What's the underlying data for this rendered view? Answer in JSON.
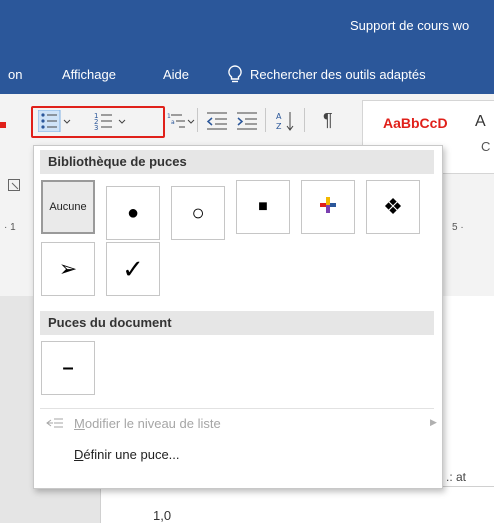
{
  "window": {
    "title": "Support de cours wo"
  },
  "menubar": {
    "items": [
      {
        "label": "on"
      },
      {
        "label": "Affichage"
      },
      {
        "label": "Aide"
      }
    ],
    "search_label": "Rechercher des outils adaptés"
  },
  "ribbon": {
    "style_sample": "AaBbCcD",
    "style_letter": "A",
    "style_letter2": "C"
  },
  "ruler": {
    "left_marks": "· 1",
    "right_marks": "5 ·"
  },
  "dropdown": {
    "library_header": "Bibliothèque de puces",
    "none_label": "Aucune",
    "bullets": [
      {
        "name": "filled-circle",
        "glyph": "●"
      },
      {
        "name": "hollow-circle",
        "glyph": "○"
      },
      {
        "name": "filled-square",
        "glyph": "■"
      },
      {
        "name": "four-color-diamond",
        "glyph": "✜"
      },
      {
        "name": "four-diamonds",
        "glyph": "❖"
      },
      {
        "name": "arrowhead",
        "glyph": "➢"
      },
      {
        "name": "checkmark",
        "glyph": "✓"
      }
    ],
    "document_header": "Puces du document",
    "document_bullets": [
      {
        "name": "dash",
        "glyph": "–"
      }
    ],
    "change_level": {
      "label_rest": "odifier le niveau de liste",
      "label_underlined": "M"
    },
    "define_bullet": {
      "label_underlined": "D",
      "label_rest": "éfinir une puce..."
    }
  },
  "document": {
    "side_text": ".: at",
    "spacing_value": "1,0"
  },
  "colors": {
    "titlebar": "#2b579a",
    "highlight": "#e0201a",
    "section_bg": "#e6e6e6"
  }
}
